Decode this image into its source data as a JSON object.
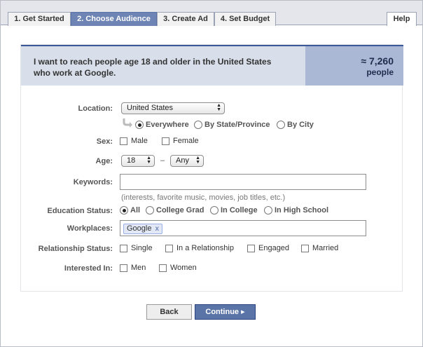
{
  "tabs": [
    {
      "label": "1. Get Started"
    },
    {
      "label": "2. Choose Audience"
    },
    {
      "label": "3. Create Ad"
    },
    {
      "label": "4. Set Budget"
    }
  ],
  "help_label": "Help",
  "summary": {
    "text": "I want to reach people age 18 and older in the United States who work at Google.",
    "audience_count": "≈ 7,260",
    "audience_unit": "people"
  },
  "form": {
    "location": {
      "label": "Location:",
      "value": "United States",
      "options": [
        "Everywhere",
        "By State/Province",
        "By City"
      ],
      "selected": "Everywhere"
    },
    "sex": {
      "label": "Sex:",
      "options": [
        "Male",
        "Female"
      ]
    },
    "age": {
      "label": "Age:",
      "from": "18",
      "separator": "–",
      "to": "Any"
    },
    "keywords": {
      "label": "Keywords:",
      "value": "",
      "hint": "(interests, favorite music, movies, job titles, etc.)"
    },
    "education": {
      "label": "Education Status:",
      "options": [
        "All",
        "College Grad",
        "In College",
        "In High School"
      ],
      "selected": "All"
    },
    "workplaces": {
      "label": "Workplaces:",
      "token": "Google",
      "remove": "x"
    },
    "relationship": {
      "label": "Relationship Status:",
      "options": [
        "Single",
        "In a Relationship",
        "Engaged",
        "Married"
      ]
    },
    "interested_in": {
      "label": "Interested In:",
      "options": [
        "Men",
        "Women"
      ]
    }
  },
  "buttons": {
    "back": "Back",
    "continue": "Continue ▸"
  }
}
